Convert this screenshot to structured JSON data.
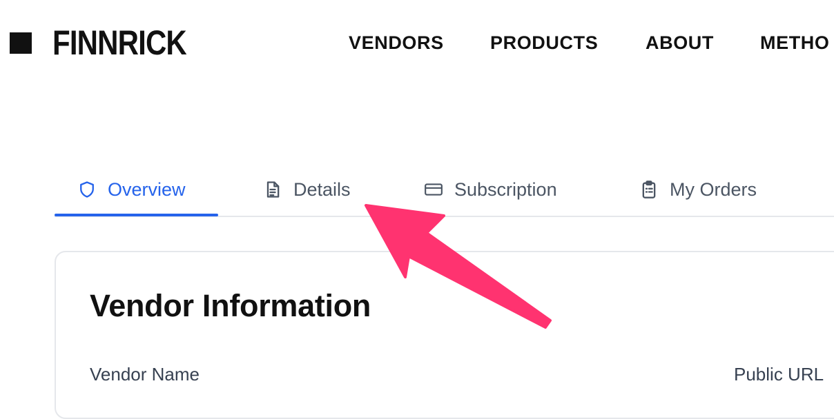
{
  "header": {
    "logo_text": "FINNRICK",
    "nav": [
      "VENDORS",
      "PRODUCTS",
      "ABOUT",
      "METHO"
    ]
  },
  "tabs": [
    {
      "label": "Overview",
      "icon": "shield-icon",
      "active": true
    },
    {
      "label": "Details",
      "icon": "document-icon",
      "active": false
    },
    {
      "label": "Subscription",
      "icon": "credit-card-icon",
      "active": false
    },
    {
      "label": "My Orders",
      "icon": "clipboard-list-icon",
      "active": false
    }
  ],
  "card": {
    "title": "Vendor Information",
    "fields": [
      "Vendor Name",
      "Public URL"
    ]
  },
  "colors": {
    "accent": "#2563eb",
    "annotation_arrow": "#ff3370",
    "inactive_tab_text": "#4b5563"
  }
}
